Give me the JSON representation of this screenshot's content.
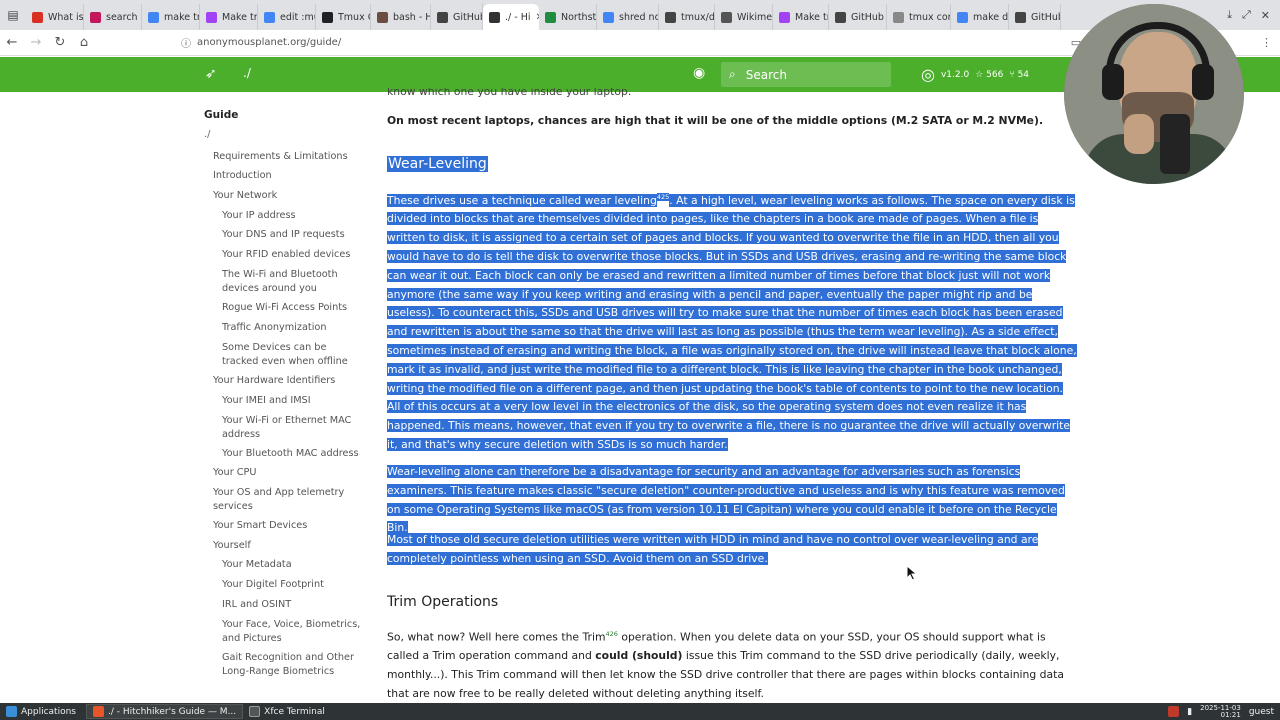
{
  "browser": {
    "tabs": [
      {
        "label": "What is",
        "color": "#d93025"
      },
      {
        "label": "search",
        "color": "#c2185b"
      },
      {
        "label": "make tr",
        "color": "#4285f4"
      },
      {
        "label": "Make tr",
        "color": "#a142f4"
      },
      {
        "label": "edit :mu",
        "color": "#4285f4"
      },
      {
        "label": "Tmux C",
        "color": "#202124"
      },
      {
        "label": "bash - H",
        "color": "#6d4c41"
      },
      {
        "label": "GitHub",
        "color": "#444"
      },
      {
        "label": "./ - Hi",
        "color": "#333",
        "active": true
      },
      {
        "label": "Northst",
        "color": "#1e8e3e"
      },
      {
        "label": "shred nc",
        "color": "#4285f4"
      },
      {
        "label": "tmux/do",
        "color": "#444"
      },
      {
        "label": "Wikime",
        "color": "#555"
      },
      {
        "label": "Make tr",
        "color": "#a142f4"
      },
      {
        "label": "GitHub",
        "color": "#444"
      },
      {
        "label": "tmux config",
        "color": "#888"
      },
      {
        "label": "make de",
        "color": "#4285f4"
      },
      {
        "label": "GitHub",
        "color": "#444"
      }
    ],
    "url": "anonymousplanet.org/guide/"
  },
  "site": {
    "title": "./",
    "search_placeholder": "Search",
    "repo_version": "v1.2.0",
    "repo_stars": "☆ 566",
    "repo_forks": "⑂ 54",
    "accent": "#4caf2c"
  },
  "sidebar": {
    "title": "Guide",
    "subtitle": "./",
    "items": [
      {
        "label": "Requirements & Limitations"
      },
      {
        "label": "Introduction"
      },
      {
        "label": "Your Network"
      },
      {
        "label": "Your IP address"
      },
      {
        "label": "Your DNS and IP requests"
      },
      {
        "label": "Your RFID enabled devices"
      },
      {
        "label": "The Wi-Fi and Bluetooth devices around you"
      },
      {
        "label": "Rogue Wi-Fi Access Points"
      },
      {
        "label": "Traffic Anonymization"
      },
      {
        "label": "Some Devices can be tracked even when offline"
      },
      {
        "label": "Your Hardware Identifiers"
      },
      {
        "label": "Your IMEI and IMSI"
      },
      {
        "label": "Your Wi-Fi or Ethernet MAC address"
      },
      {
        "label": "Your Bluetooth MAC address"
      },
      {
        "label": "Your CPU"
      },
      {
        "label": "Your OS and App telemetry services"
      },
      {
        "label": "Your Smart Devices"
      },
      {
        "label": "Yourself"
      },
      {
        "label": "Your Metadata"
      },
      {
        "label": "Your Digitel Footprint"
      },
      {
        "label": "IRL and OSINT"
      },
      {
        "label": "Your Face, Voice, Biometrics, and Pictures"
      },
      {
        "label": "Gait Recognition and Other Long-Range Biometrics"
      }
    ]
  },
  "content": {
    "top_partial": "know which one you have inside your laptop.",
    "intro": "On most recent laptops, chances are high that it will be one of the middle options (M.2 SATA or M.2 NVMe).",
    "h_wear": "Wear-Leveling",
    "p1_a": "These drives use a technique called wear leveling",
    "p1_ref": "425",
    "p1_b": ". At a high level, wear leveling works as follows. The space on every disk is divided into blocks that are themselves divided into pages, like the chapters in a book are made of pages. When a file is written to disk, it is assigned to a certain set of pages and blocks. If you wanted to overwrite the file in an HDD, then all you would have to do is tell the disk to overwrite those blocks. But in SSDs and USB drives, erasing and re-writing the same block can wear it out. Each block can only be erased and rewritten a limited number of times before that block just will not work anymore (the same way if you keep writing and erasing with a pencil and paper, eventually the paper might rip and be useless). To counteract this, SSDs and USB drives will try to make sure that the number of times each block has been erased and rewritten is about the same so that the drive will last as long as possible (thus the term wear leveling). As a side effect, sometimes instead of erasing and writing the block, a file was originally stored on, the drive will instead leave that block alone, mark it as invalid, and just write the modified file to a different block. This is like leaving the chapter in the book unchanged, writing the modified file on a different page, and then just updating the book's table of contents to point to the new location. All of this occurs at a very low level in the electronics of the disk, so the operating system does not even realize it has happened. This means, however, that even if you try to overwrite a file, there is no guarantee the drive will actually overwrite it, and that's why secure deletion with SSDs is so much harder.",
    "p2": "Wear-leveling alone can therefore be a disadvantage for security and an advantage for adversaries such as forensics examiners. This feature makes classic \"secure deletion\" counter-productive and useless and is why this feature was removed on some Operating Systems like macOS (as from version 10.11 El Capitan) where you could enable it before on the Recycle Bin.",
    "p3": "Most of those old secure deletion utilities were written with HDD in mind and have no control over wear-leveling and are completely pointless when using an SSD. Avoid them on an SSD drive.",
    "h_trim": "Trim Operations",
    "p4_a": "So, what now? Well here comes the Trim",
    "p4_ref": "426",
    "p4_b": " operation. When you delete data on your SSD, your OS should support what is called a Trim operation command and ",
    "p4_bold": "could (should)",
    "p4_c": " issue this Trim command to the SSD drive periodically (daily, weekly, monthly...). This Trim command will then let know the SSD drive controller that there are pages within blocks containing data that are now free to be really deleted without deleting anything itself."
  },
  "taskbar": {
    "applications": "Applications",
    "window1": "./ - Hitchhiker's Guide — M...",
    "window2": "Xfce Terminal",
    "date": "2025-11-03",
    "time": "01:21",
    "user": "guest"
  }
}
